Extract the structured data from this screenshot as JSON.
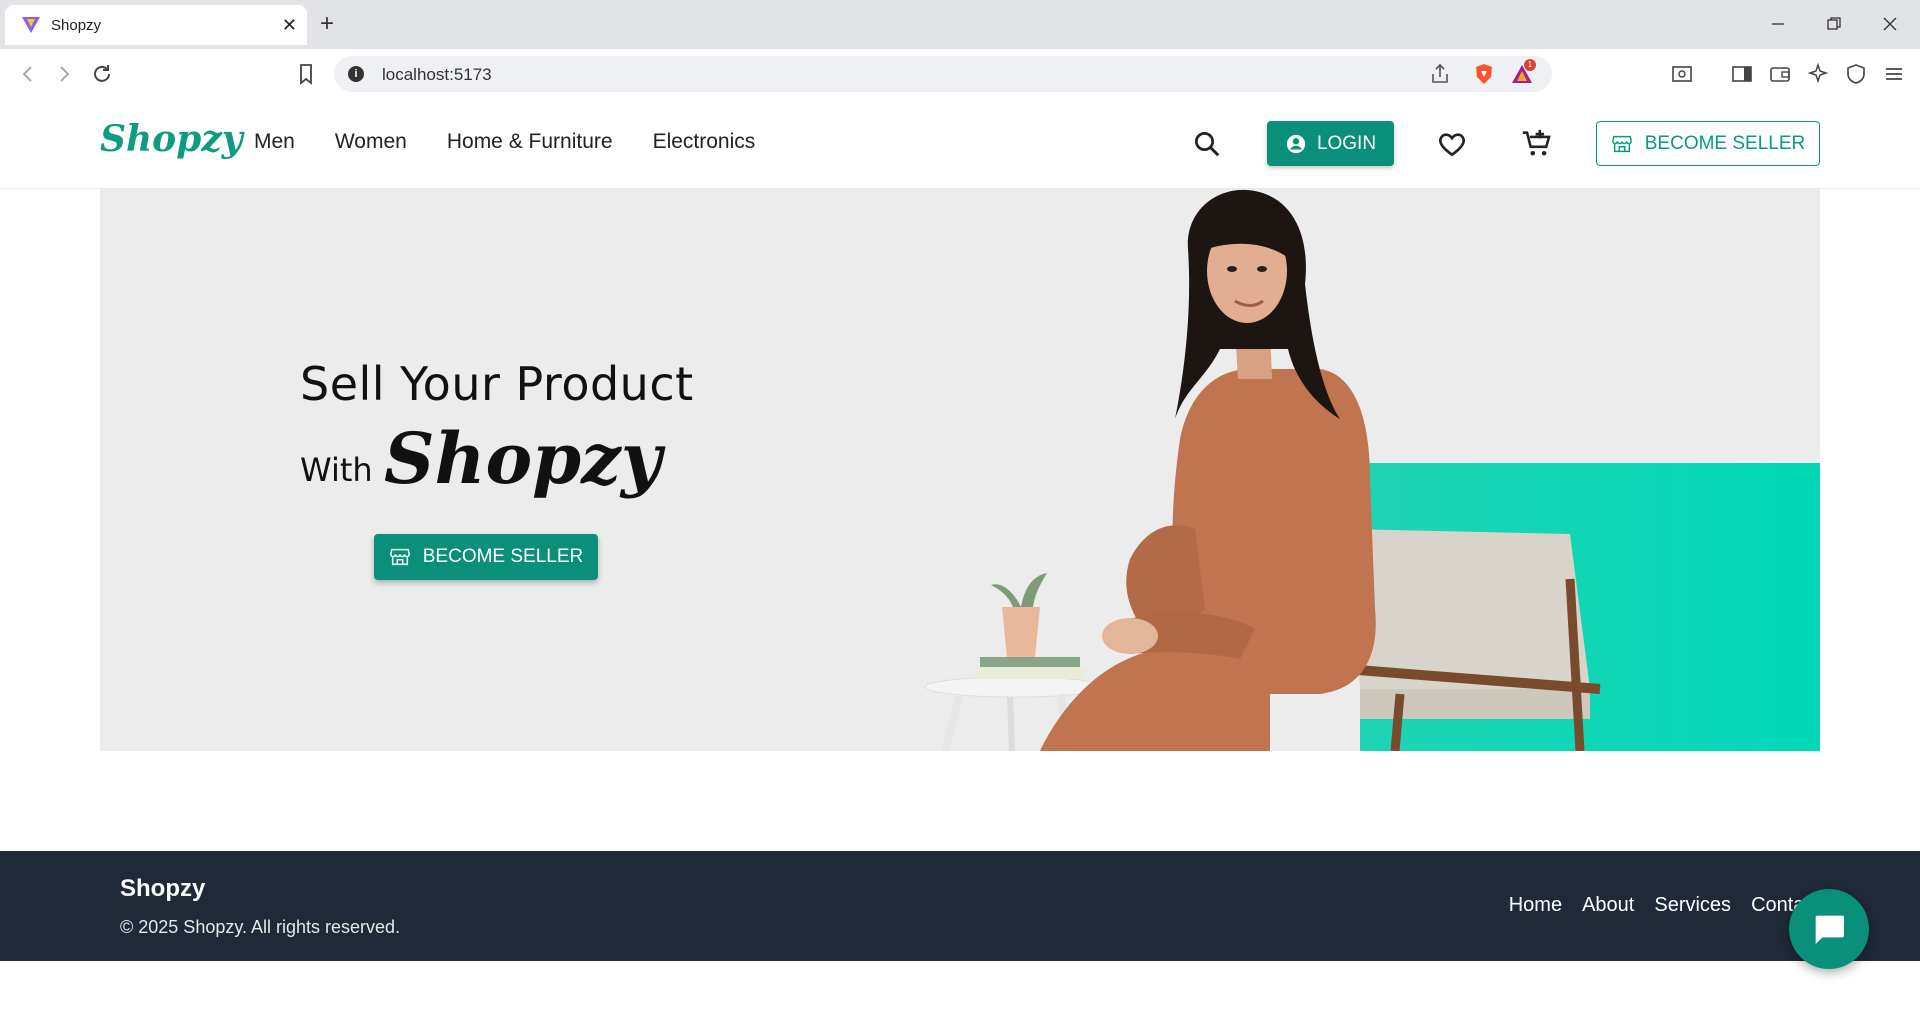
{
  "browser": {
    "tab_title": "Shopzy",
    "url": "localhost:5173",
    "new_tab_glyph": "+",
    "tab_close_glyph": "✕",
    "window_controls": [
      "minimize-icon",
      "restore-icon",
      "close-icon"
    ],
    "notification_badge": "1"
  },
  "header": {
    "brand": "Shopzy",
    "nav": [
      "Men",
      "Women",
      "Home & Furniture",
      "Electronics"
    ],
    "login_label": "LOGIN",
    "become_seller_label": "BECOME SELLER",
    "icons": [
      "search-icon",
      "wishlist-heart-icon",
      "cart-add-icon"
    ]
  },
  "hero": {
    "headline": "Sell Your Product",
    "with_text": "With",
    "brand_script": "Shopzy",
    "cta_label": "BECOME SELLER"
  },
  "footer": {
    "brand": "Shopzy",
    "copyright": "© 2025 Shopzy. All rights reserved.",
    "links": [
      "Home",
      "About",
      "Services",
      "Contact"
    ]
  },
  "colors": {
    "brand_teal": "#0a8f7a",
    "hero_accent": "#00d8b6",
    "footer_bg": "#1f2937",
    "hero_bg": "#ececec"
  }
}
